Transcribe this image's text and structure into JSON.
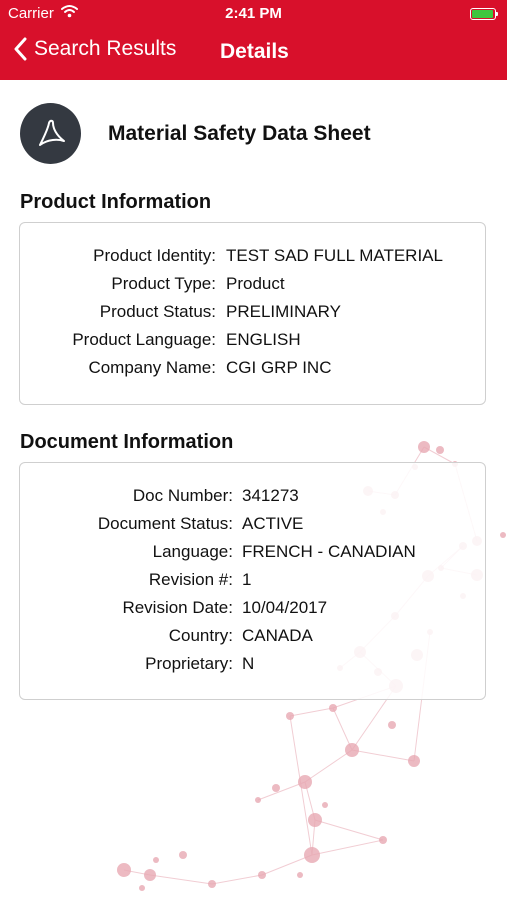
{
  "status_bar": {
    "carrier": "Carrier",
    "time": "2:41 PM"
  },
  "nav": {
    "back_label": "Search Results",
    "title": "Details"
  },
  "document": {
    "title": "Material Safety Data Sheet"
  },
  "product_section": {
    "title": "Product Information",
    "fields": [
      {
        "label": "Product Identity:",
        "value": "TEST SAD FULL MATERIAL"
      },
      {
        "label": "Product Type:",
        "value": "Product"
      },
      {
        "label": "Product Status:",
        "value": "PRELIMINARY"
      },
      {
        "label": "Product Language:",
        "value": "ENGLISH"
      },
      {
        "label": "Company Name:",
        "value": "CGI GRP INC"
      }
    ]
  },
  "document_section": {
    "title": "Document Information",
    "fields": [
      {
        "label": "Doc Number:",
        "value": "341273"
      },
      {
        "label": "Document Status:",
        "value": "ACTIVE"
      },
      {
        "label": "Language:",
        "value": "FRENCH - CANADIAN"
      },
      {
        "label": "Revision #:",
        "value": "1"
      },
      {
        "label": "Revision Date:",
        "value": "10/04/2017"
      },
      {
        "label": "Country:",
        "value": "CANADA"
      },
      {
        "label": "Proprietary:",
        "value": "N"
      }
    ]
  },
  "colors": {
    "header": "#d8102b",
    "icon_bg": "#343941",
    "card_border": "#cfcfcf",
    "network_dots": "#e8a9b3"
  },
  "icons": [
    "wifi-icon",
    "battery-icon",
    "back-chevron-icon",
    "pdf-icon"
  ]
}
